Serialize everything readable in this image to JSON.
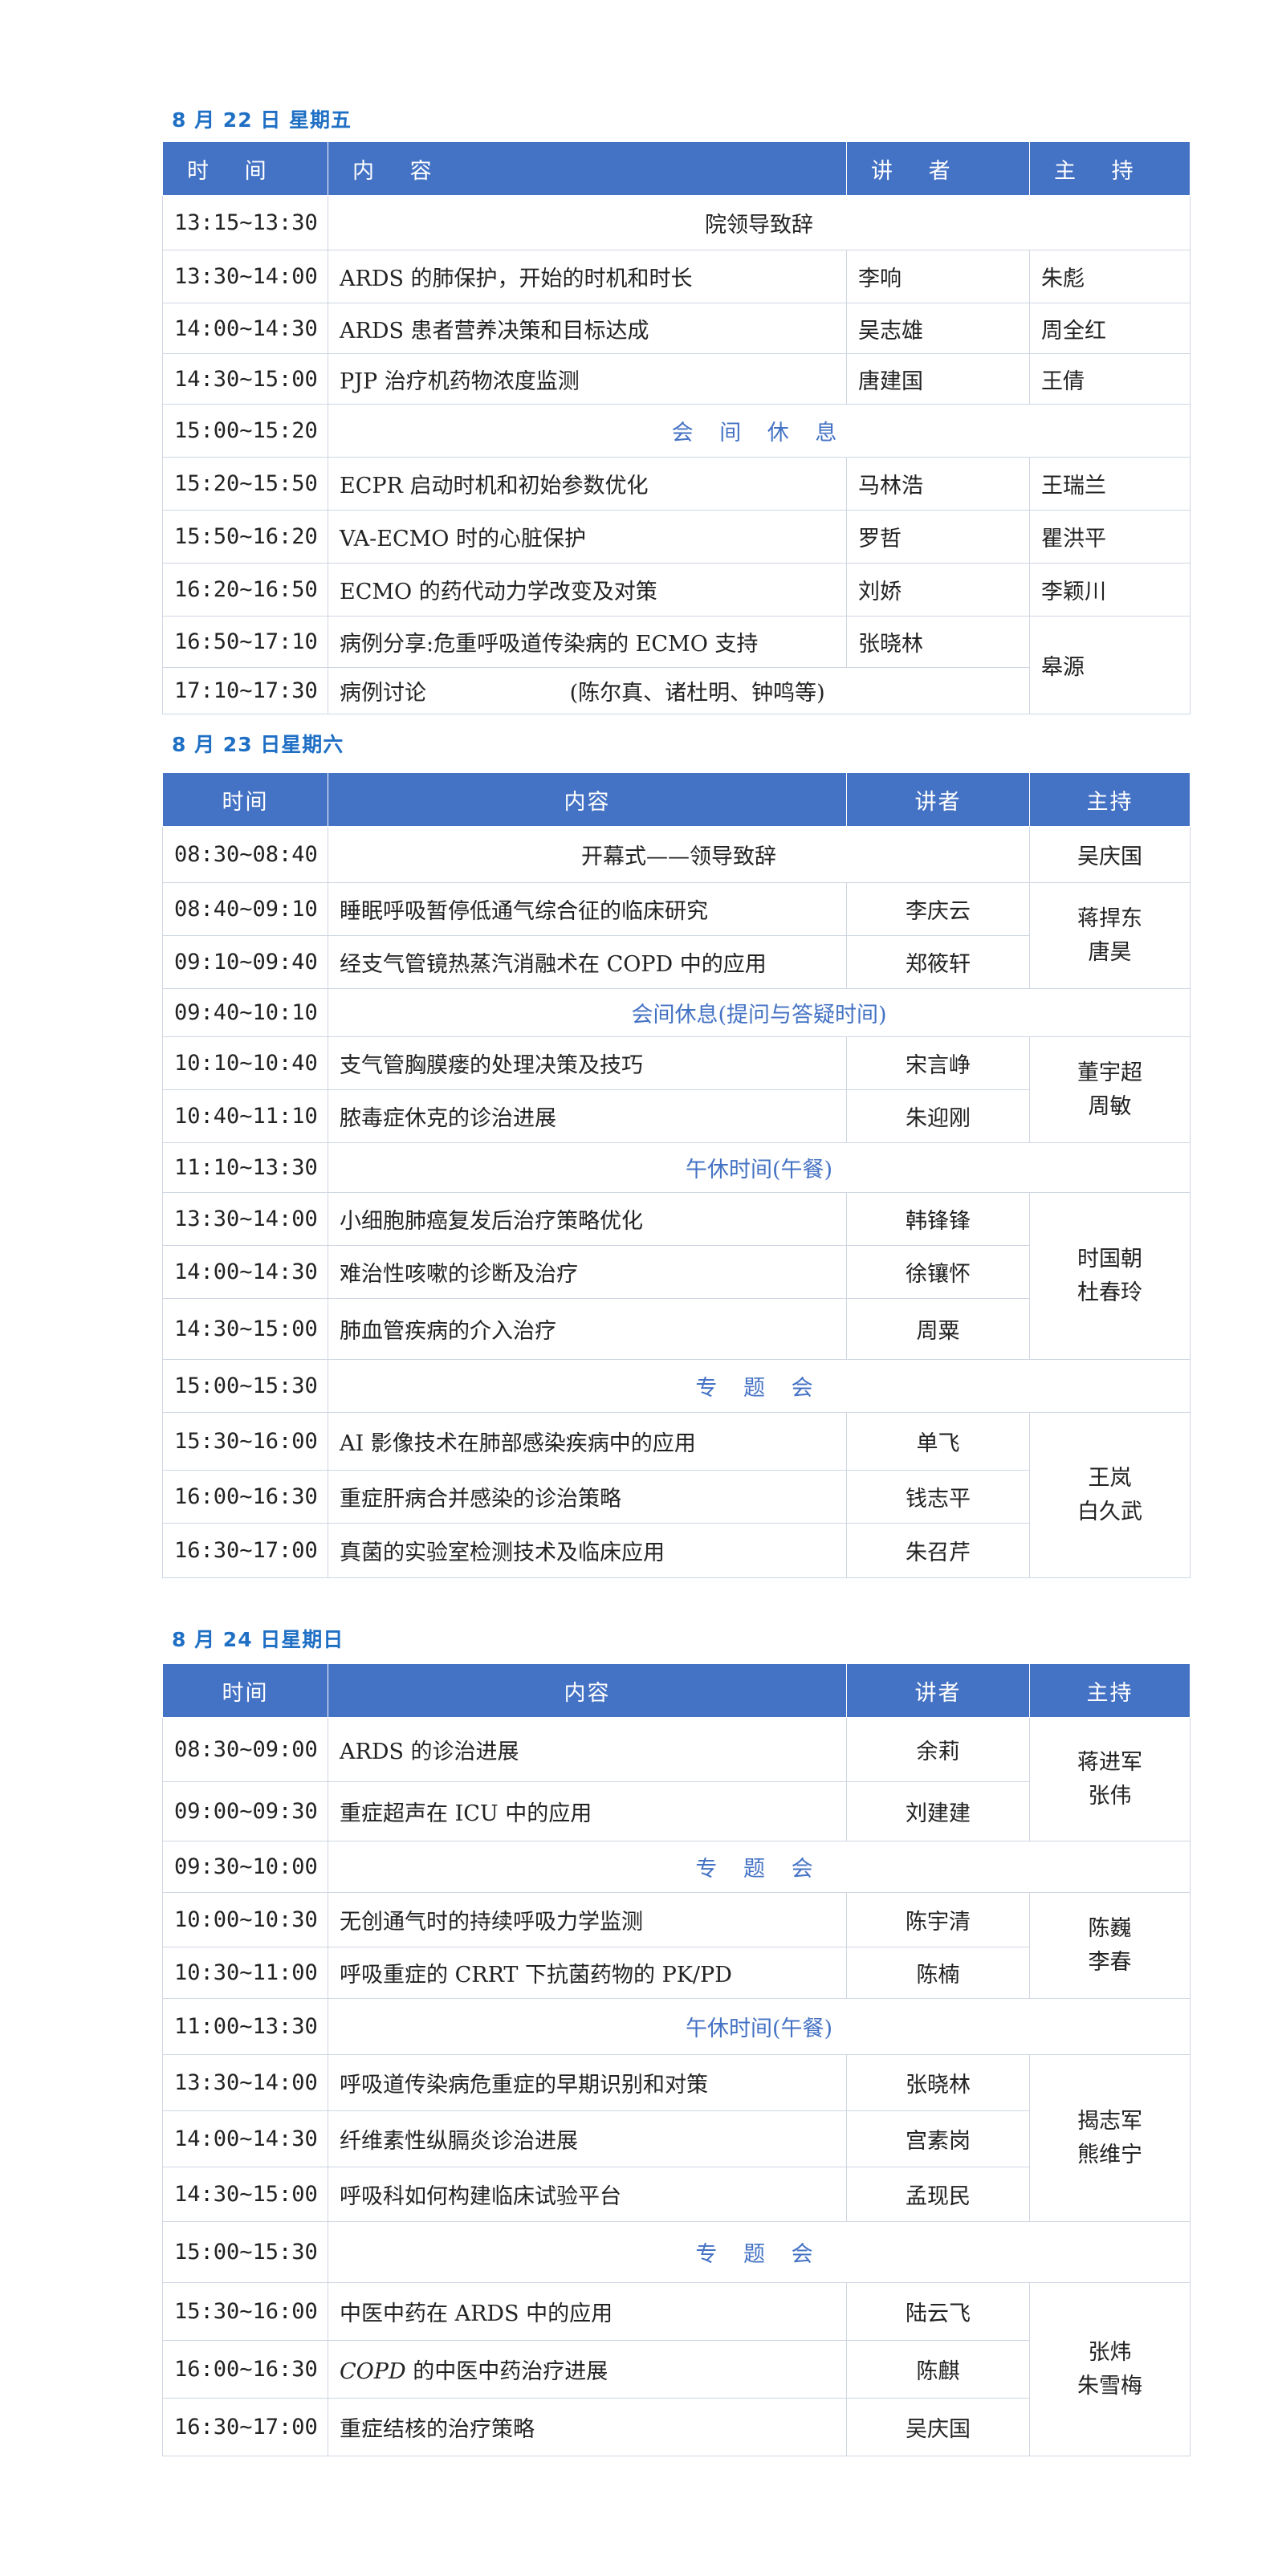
{
  "day1": {
    "heading": "8 月 22 日  星期五",
    "headers": {
      "time": "时  间",
      "content": "内  容",
      "speaker": "讲  者",
      "host": "主  持"
    },
    "rows": [
      {
        "time": "13:15~13:30",
        "merged": "院领导致辞"
      },
      {
        "time": "13:30~14:00",
        "content": "ARDS 的肺保护，开始的时机和时长",
        "speaker": "李响",
        "host": "朱彪"
      },
      {
        "time": "14:00~14:30",
        "content": "ARDS 患者营养决策和目标达成",
        "speaker": "吴志雄",
        "host": "周全红"
      },
      {
        "time": "14:30~15:00",
        "content": "PJP 治疗机药物浓度监测",
        "speaker": "唐建国",
        "host": "王倩"
      },
      {
        "time": "15:00~15:20",
        "break": "会 间 休 息"
      },
      {
        "time": "15:20~15:50",
        "content": "ECPR 启动时机和初始参数优化",
        "speaker": "马林浩",
        "host": "王瑞兰"
      },
      {
        "time": "15:50~16:20",
        "content": "VA-ECMO 时的心脏保护",
        "speaker": "罗哲",
        "host": "瞿洪平"
      },
      {
        "time": "16:20~16:50",
        "content": "ECMO 的药代动力学改变及对策",
        "speaker": "刘娇",
        "host": "李颖川"
      },
      {
        "time": "16:50~17:10",
        "content": "病例分享:危重呼吸道传染病的 ECMO 支持",
        "speaker": "张晓林",
        "host": "皋源"
      },
      {
        "time": "17:10~17:30",
        "content": "病例讨论",
        "speaker_group": "(陈尔真、诸杜明、钟鸣等)"
      }
    ]
  },
  "day2": {
    "heading": "8 月 23 日星期六",
    "headers": {
      "time": "时间",
      "content": "内容",
      "speaker": "讲者",
      "host": "主持"
    },
    "rows": [
      {
        "time": "08:30~08:40",
        "merged": "开幕式——领导致辞",
        "host": "吴庆国"
      },
      {
        "time": "08:40~09:10",
        "content": "睡眠呼吸暂停低通气综合征的临床研究",
        "speaker": "李庆云",
        "host": [
          "蒋捍东",
          "唐昊"
        ]
      },
      {
        "time": "09:10~09:40",
        "content": "经支气管镜热蒸汽消融术在 COPD 中的应用",
        "speaker": "郑筱轩"
      },
      {
        "time": "09:40~10:10",
        "break": "会间休息(提问与答疑时间)"
      },
      {
        "time": "10:10~10:40",
        "content": "支气管胸膜瘘的处理决策及技巧",
        "speaker": "宋言峥",
        "host": [
          "董宇超",
          "周敏"
        ]
      },
      {
        "time": "10:40~11:10",
        "content": "脓毒症休克的诊治进展",
        "speaker": "朱迎刚"
      },
      {
        "time": "11:10~13:30",
        "break": "午休时间(午餐)"
      },
      {
        "time": "13:30~14:00",
        "content": "小细胞肺癌复发后治疗策略优化",
        "speaker": "韩锋锋",
        "host": [
          "时国朝",
          "杜春玲"
        ]
      },
      {
        "time": "14:00~14:30",
        "content": "难治性咳嗽的诊断及治疗",
        "speaker": "徐镶怀"
      },
      {
        "time": "14:30~15:00",
        "content": "肺血管疾病的介入治疗",
        "speaker": "周粟"
      },
      {
        "time": "15:00~15:30",
        "break": "专 题 会"
      },
      {
        "time": "15:30~16:00",
        "content": "AI 影像技术在肺部感染疾病中的应用",
        "speaker": "单飞",
        "host": [
          "王岚",
          "白久武"
        ]
      },
      {
        "time": "16:00~16:30",
        "content": "重症肝病合并感染的诊治策略",
        "speaker": "钱志平"
      },
      {
        "time": "16:30~17:00",
        "content": "真菌的实验室检测技术及临床应用",
        "speaker": "朱召芹"
      }
    ]
  },
  "day3": {
    "heading": "8 月 24 日星期日",
    "headers": {
      "time": "时间",
      "content": "内容",
      "speaker": "讲者",
      "host": "主持"
    },
    "rows": [
      {
        "time": "08:30~09:00",
        "content": "ARDS 的诊治进展",
        "speaker": "余莉",
        "host": [
          "蒋进军",
          "张伟"
        ]
      },
      {
        "time": "09:00~09:30",
        "content": "重症超声在 ICU 中的应用",
        "speaker": "刘建建"
      },
      {
        "time": "09:30~10:00",
        "break": "专 题 会"
      },
      {
        "time": "10:00~10:30",
        "content": "无创通气时的持续呼吸力学监测",
        "speaker": "陈宇清",
        "host": [
          "陈巍",
          "李春"
        ]
      },
      {
        "time": "10:30~11:00",
        "content": "呼吸重症的 CRRT 下抗菌药物的 PK/PD",
        "speaker": "陈楠"
      },
      {
        "time": "11:00~13:30",
        "break": "午休时间(午餐)"
      },
      {
        "time": "13:30~14:00",
        "content": "呼吸道传染病危重症的早期识别和对策",
        "speaker": "张晓林",
        "host": [
          "揭志军",
          "熊维宁"
        ]
      },
      {
        "time": "14:00~14:30",
        "content": "纤维素性纵膈炎诊治进展",
        "speaker": "宫素岗"
      },
      {
        "time": "14:30~15:00",
        "content": "呼吸科如何构建临床试验平台",
        "speaker": "孟现民"
      },
      {
        "time": "15:00~15:30",
        "break": "专 题 会"
      },
      {
        "time": "15:30~16:00",
        "content": "中医中药在 ARDS 中的应用",
        "speaker": "陆云飞",
        "host": [
          "张炜",
          "朱雪梅"
        ]
      },
      {
        "time": "16:00~16:30",
        "content_italic": "COPD",
        "content": " 的中医中药治疗进展",
        "speaker": "陈麒"
      },
      {
        "time": "16:30~17:00",
        "content": "重症结核的治疗策略",
        "speaker": "吴庆国"
      }
    ]
  }
}
